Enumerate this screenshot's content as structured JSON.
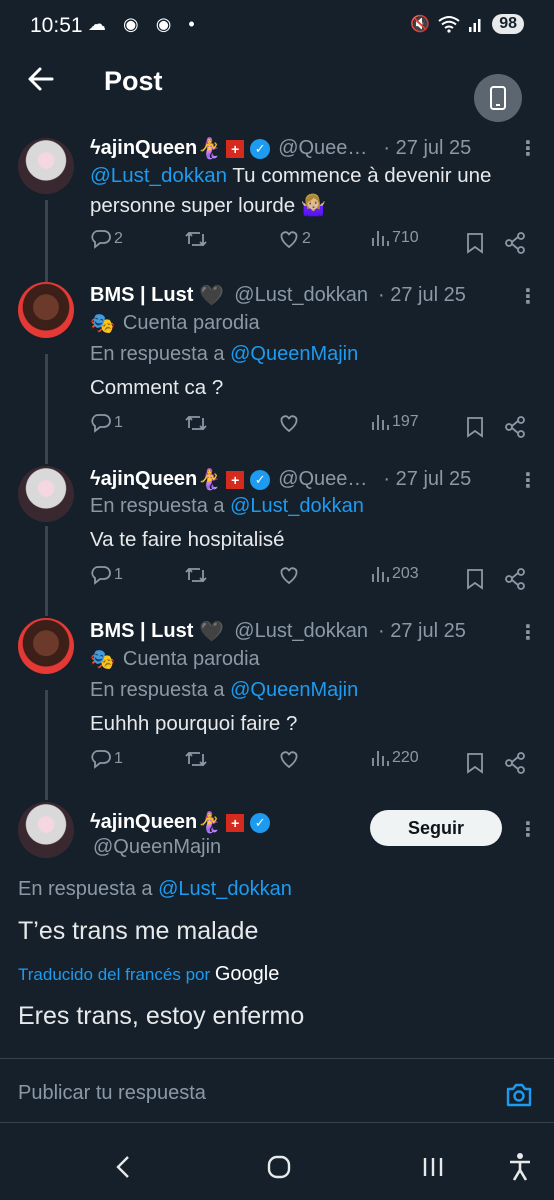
{
  "status": {
    "time": "10:51",
    "icons": "☁ ◉ ◉ •",
    "battery": "98"
  },
  "header": {
    "title": "Post"
  },
  "tweets": [
    {
      "name": "ϟajinQueen",
      "emoji": "🧜‍♀️",
      "handle": "@Quee…",
      "date": "· 27 jul 25",
      "mention": "@Lust_dokkan",
      "text_line1": " Tu commence à devenir une",
      "text_line2": "personne super lourde 🤷🏼‍♀️",
      "replies": "2",
      "likes": "2",
      "views": "710"
    },
    {
      "name": "BMS | Lust",
      "emoji": "🖤",
      "handle": "@Lust_dokkan",
      "date": "· 27 jul 25",
      "parody_label": "Cuenta parodia",
      "reply_prefix": "En respuesta a ",
      "reply_to": "@QueenMajin",
      "text": "Comment ca ?",
      "replies": "1",
      "views": "197"
    },
    {
      "name": "ϟajinQueen",
      "emoji": "🧜‍♀️",
      "handle": "@Quee…",
      "date": "· 27 jul 25",
      "reply_prefix": "En respuesta a ",
      "reply_to": "@Lust_dokkan",
      "text": "Va te faire hospitalisé",
      "replies": "1",
      "views": "203"
    },
    {
      "name": "BMS | Lust",
      "emoji": "🖤",
      "handle": "@Lust_dokkan",
      "date": "· 27 jul 25",
      "parody_label": "Cuenta parodia",
      "reply_prefix": "En respuesta a ",
      "reply_to": "@QueenMajin",
      "text": "Euhhh pourquoi faire ?",
      "replies": "1",
      "views": "220"
    }
  ],
  "main": {
    "name": "ϟajinQueen",
    "emoji": "🧜‍♀️",
    "handle": "@QueenMajin",
    "follow_label": "Seguir",
    "reply_prefix": "En respuesta a ",
    "reply_to": "@Lust_dokkan",
    "text": "T’es trans me malade",
    "translated_by": "Traducido del francés por",
    "google": "Google",
    "translation": "Eres trans, estoy enfermo"
  },
  "reply_box": {
    "placeholder": "Publicar tu respuesta"
  },
  "colors": {
    "background": "#15202b",
    "accent": "#1d9bf0",
    "muted": "#8b98a5"
  }
}
